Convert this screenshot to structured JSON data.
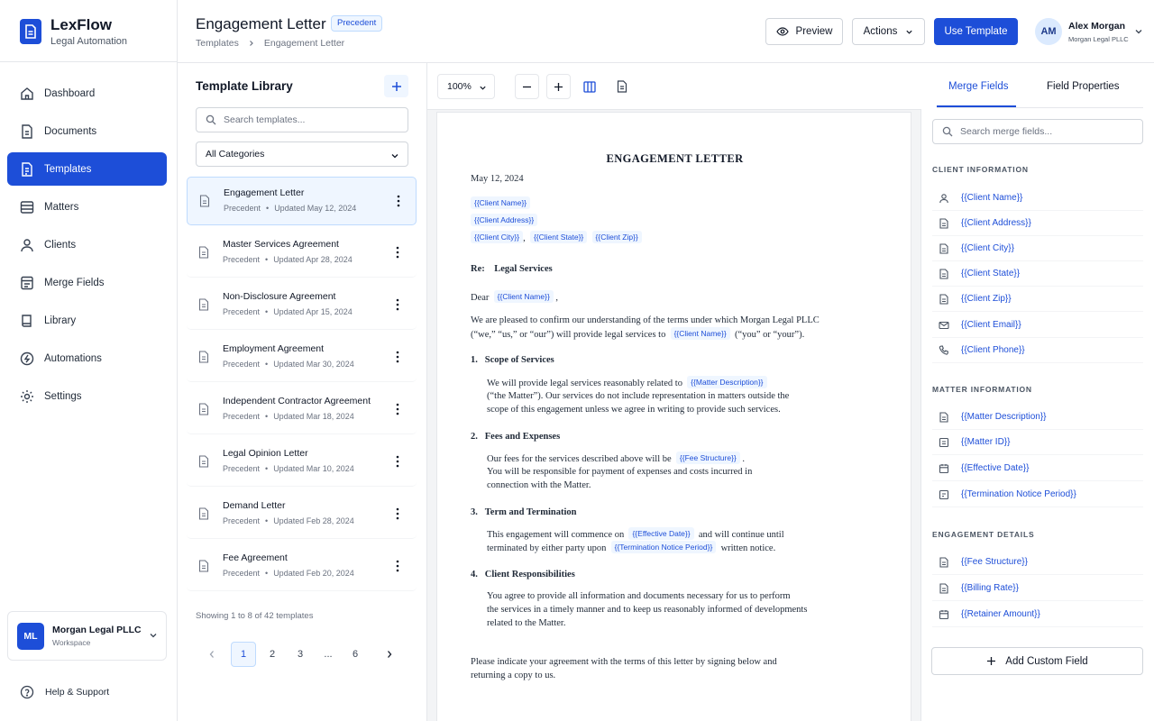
{
  "brand": {
    "name": "LexFlow",
    "subtitle": "Legal Automation"
  },
  "nav": [
    {
      "label": "Dashboard",
      "icon": "home-icon",
      "active": false
    },
    {
      "label": "Documents",
      "icon": "document-icon",
      "active": false
    },
    {
      "label": "Templates",
      "icon": "template-icon",
      "active": true
    },
    {
      "label": "Matters",
      "icon": "folder-icon",
      "active": false
    },
    {
      "label": "Clients",
      "icon": "user-icon",
      "active": false
    },
    {
      "label": "Merge Fields",
      "icon": "merge-icon",
      "active": false
    },
    {
      "label": "Library",
      "icon": "book-icon",
      "active": false
    },
    {
      "label": "Automations",
      "icon": "automation-icon",
      "active": false
    },
    {
      "label": "Settings",
      "icon": "gear-icon",
      "active": false
    }
  ],
  "workspace": {
    "initials": "ML",
    "name": "Morgan Legal PLLC",
    "label": "Workspace"
  },
  "help": {
    "label": "Help & Support"
  },
  "header": {
    "title": "Engagement Letter",
    "badge": "Precedent",
    "breadcrumb": [
      "Templates",
      "Engagement Letter"
    ],
    "preview_label": "Preview",
    "actions_label": "Actions",
    "use_template_label": "Use Template",
    "user": {
      "initials": "AM",
      "name": "Alex Morgan",
      "org": "Morgan Legal PLLC"
    }
  },
  "library": {
    "title": "Template Library",
    "search_placeholder": "Search templates...",
    "category": "All Categories",
    "templates": [
      {
        "name": "Engagement Letter",
        "type": "Precedent",
        "updated": "Updated May 12, 2024",
        "active": true
      },
      {
        "name": "Master Services Agreement",
        "type": "Precedent",
        "updated": "Updated Apr 28, 2024",
        "active": false
      },
      {
        "name": "Non-Disclosure Agreement",
        "type": "Precedent",
        "updated": "Updated Apr 15, 2024",
        "active": false
      },
      {
        "name": "Employment Agreement",
        "type": "Precedent",
        "updated": "Updated Mar 30, 2024",
        "active": false
      },
      {
        "name": "Independent Contractor Agreement",
        "type": "Precedent",
        "updated": "Updated Mar 18, 2024",
        "active": false
      },
      {
        "name": "Legal Opinion Letter",
        "type": "Precedent",
        "updated": "Updated Mar 10, 2024",
        "active": false
      },
      {
        "name": "Demand Letter",
        "type": "Precedent",
        "updated": "Updated Feb 28, 2024",
        "active": false
      },
      {
        "name": "Fee Agreement",
        "type": "Precedent",
        "updated": "Updated Feb 20, 2024",
        "active": false
      }
    ],
    "showing": "Showing 1 to 8 of 42 templates",
    "pages": [
      "1",
      "2",
      "3",
      "...",
      "6"
    ],
    "current_page": "1"
  },
  "toolbar": {
    "zoom": "100%"
  },
  "document": {
    "title": "ENGAGEMENT LETTER",
    "date": "May 12, 2024",
    "client_name_token": "{{Client Name}}",
    "client_address_token": "{{Client Address}}",
    "client_city_token": "{{Client City}}",
    "comma": ",",
    "client_state_token": "{{Client State}}",
    "client_zip_token": "{{Client Zip}}",
    "re_label": "Re:",
    "re_subject": "Legal Services",
    "dear": "Dear",
    "dear_comma": ",",
    "intro_line1": "We are pleased to confirm our understanding of the terms under which Morgan Legal PLLC",
    "intro_line2_a": "(“we,” “us,” or “our”) will provide legal services to",
    "intro_line2_b": "(“you” or “your”).",
    "s1_num": "1.",
    "s1_title": "Scope of Services",
    "s1_l1_a": "We will provide legal services reasonably related to",
    "matter_description_token": "{{Matter Description}}",
    "s1_l2": "(“the Matter”). Our services do not include representation in matters outside the",
    "s1_l3": "scope of this engagement unless we agree in writing to provide such services.",
    "s2_num": "2.",
    "s2_title": "Fees and Expenses",
    "s2_l1_a": "Our fees for the services described above will be",
    "fee_structure_token": "{{Fee Structure}}",
    "s2_l1_b": ".",
    "s2_l2": "You will be responsible for payment of expenses and costs incurred in",
    "s2_l3": "connection with the Matter.",
    "s3_num": "3.",
    "s3_title": "Term and Termination",
    "s3_l1_a": "This engagement will commence on",
    "effective_date_token": "{{Effective Date}}",
    "s3_l1_b": "and will continue until",
    "s3_l2_a": "terminated by either party upon",
    "termination_token": "{{Termination Notice Period}}",
    "s3_l2_b": "written notice.",
    "s4_num": "4.",
    "s4_title": "Client Responsibilities",
    "s4_l1": "You agree to provide all information and documents necessary for us to perform",
    "s4_l2": "the services in a timely manner and to keep us reasonably informed of developments",
    "s4_l3": "related to the Matter.",
    "closing_l1": "Please indicate your agreement with the terms of this letter by signing below and",
    "closing_l2": "returning a copy to us."
  },
  "merge_panel": {
    "tabs": [
      "Merge Fields",
      "Field Properties"
    ],
    "search_placeholder": "Search merge fields...",
    "groups": [
      {
        "title": "CLIENT INFORMATION",
        "fields": [
          {
            "label": "{{Client Name}}",
            "icon": "person-icon"
          },
          {
            "label": "{{Client Address}}",
            "icon": "field-doc-icon"
          },
          {
            "label": "{{Client City}}",
            "icon": "field-doc-icon"
          },
          {
            "label": "{{Client State}}",
            "icon": "field-doc-icon"
          },
          {
            "label": "{{Client Zip}}",
            "icon": "field-doc-icon"
          },
          {
            "label": "{{Client Email}}",
            "icon": "mail-icon"
          },
          {
            "label": "{{Client Phone}}",
            "icon": "phone-icon"
          }
        ]
      },
      {
        "title": "MATTER INFORMATION",
        "fields": [
          {
            "label": "{{Matter Description}}",
            "icon": "field-doc-icon"
          },
          {
            "label": "{{Matter ID}}",
            "icon": "field-doc-icon"
          },
          {
            "label": "{{Effective Date}}",
            "icon": "calendar-icon"
          },
          {
            "label": "{{Termination Notice Period}}",
            "icon": "field-doc-icon"
          }
        ]
      },
      {
        "title": "ENGAGEMENT DETAILS",
        "fields": [
          {
            "label": "{{Fee Structure}}",
            "icon": "field-doc-icon"
          },
          {
            "label": "{{Billing Rate}}",
            "icon": "field-doc-icon"
          },
          {
            "label": "{{Retainer Amount}}",
            "icon": "calendar-icon"
          }
        ]
      }
    ],
    "add_label": "Add Custom Field"
  },
  "colors": {
    "accent": "#1d4ed8",
    "accent_light": "#eff6ff",
    "border": "#e5e7eb"
  }
}
